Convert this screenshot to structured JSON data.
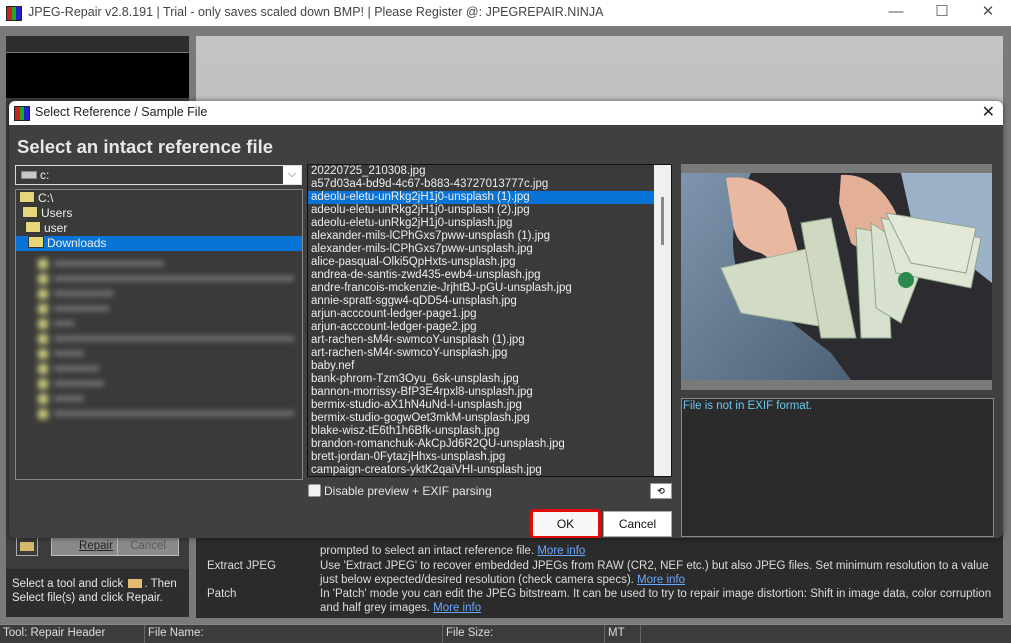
{
  "window": {
    "title": "JPEG-Repair v2.8.191 | Trial - only saves scaled down BMP! | Please Register @: JPEGREPAIR.NINJA",
    "minimize_glyph": "—",
    "maximize_glyph": "☐",
    "close_glyph": "✕"
  },
  "dialog": {
    "title": "Select Reference / Sample File",
    "close_glyph": "✕",
    "heading": "Select an intact reference file",
    "drive": {
      "value": "c:",
      "arrow": "⌵"
    },
    "tree": [
      {
        "label": "C:\\",
        "selected": false
      },
      {
        "label": "Users",
        "selected": false
      },
      {
        "label": "user",
        "selected": false
      },
      {
        "label": "Downloads",
        "selected": true
      }
    ],
    "files": [
      "20220725_210308.jpg",
      "a57d03a4-bd9d-4c67-b883-43727013777c.jpg",
      "adeolu-eletu-unRkg2jH1j0-unsplash (1).jpg",
      "adeolu-eletu-unRkg2jH1j0-unsplash (2).jpg",
      "adeolu-eletu-unRkg2jH1j0-unsplash.jpg",
      "alexander-mils-lCPhGxs7pww-unsplash (1).jpg",
      "alexander-mils-lCPhGxs7pww-unsplash.jpg",
      "alice-pasqual-Olki5QpHxts-unsplash.jpg",
      "andrea-de-santis-zwd435-ewb4-unsplash.jpg",
      "andre-francois-mckenzie-JrjhtBJ-pGU-unsplash.jpg",
      "annie-spratt-sggw4-qDD54-unsplash.jpg",
      "arjun-acccount-ledger-page1.jpg",
      "arjun-acccount-ledger-page2.jpg",
      "art-rachen-sM4r-swmcoY-unsplash (1).jpg",
      "art-rachen-sM4r-swmcoY-unsplash.jpg",
      "baby.nef",
      "bank-phrom-Tzm3Oyu_6sk-unsplash.jpg",
      "bannon-morrissy-BfP3E4rpxl8-unsplash.jpg",
      "bermix-studio-aX1hN4uNd-I-unsplash.jpg",
      "bermix-studio-gogwOet3mkM-unsplash.jpg",
      "blake-wisz-tE6th1h6Bfk-unsplash.jpg",
      "brandon-romanchuk-AkCpJd6R2QU-unsplash.jpg",
      "brett-jordan-0FytazjHhxs-unsplash.jpg",
      "campaign-creators-yktK2qaiVHI-unsplash.jpg"
    ],
    "selected_file_index": 2,
    "disable_preview_label": "Disable preview + EXIF parsing",
    "disable_preview_checked": false,
    "refresh_glyph": "⟲",
    "exif_message": "File is not in EXIF format.",
    "ok_label": "OK",
    "cancel_label": "Cancel"
  },
  "left_panel": {
    "repair_label": "Repair",
    "cancel_label": "Cancel",
    "hint_line1": "Select a tool and click",
    "hint_line1_end": ". Then",
    "hint_line2": "Select file(s) and click Repair."
  },
  "help": {
    "rows": [
      {
        "label": "",
        "text": "prompted to select an intact reference file. ",
        "link": "More info"
      },
      {
        "label": "Extract JPEG",
        "text": "Use 'Extract JPEG' to recover embedded JPEGs from RAW (CR2, NEF etc.) but also JPEG files. Set minimum resolution to a value just below expected/desired resolution (check camera specs). ",
        "link": "More info"
      },
      {
        "label": "Patch",
        "text": "In 'Patch' mode you can edit the JPEG bitstream. It can be used to try to repair image distortion: Shift in image data, color corruption and half grey images. ",
        "link": "More info"
      }
    ]
  },
  "statusbar": {
    "tool": "Tool: Repair Header",
    "file_name": "File Name:",
    "file_size": "File Size:",
    "mt": "MT"
  },
  "colors": {
    "selection": "#0a74d6",
    "ok_highlight": "#e20b0b",
    "exif_text": "#6cc6f0",
    "link": "#6aa8ff"
  }
}
